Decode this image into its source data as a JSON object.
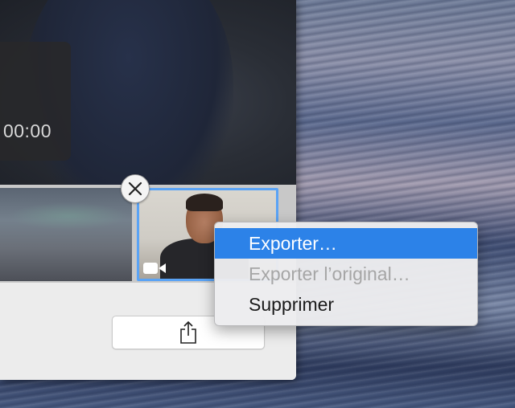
{
  "window": {
    "timer": "00:00"
  },
  "context_menu": {
    "items": [
      {
        "label": "Exporter…",
        "state": "highlighted"
      },
      {
        "label": "Exporter l’original…",
        "state": "disabled"
      },
      {
        "label": "Supprimer",
        "state": "normal"
      }
    ]
  },
  "icons": {
    "remove": "close-icon",
    "camera": "video-camera-icon",
    "share": "share-icon"
  },
  "colors": {
    "selection_border": "#5aa3f5",
    "menu_highlight": "#2c82e8",
    "disabled_text": "#a6a6a6"
  }
}
